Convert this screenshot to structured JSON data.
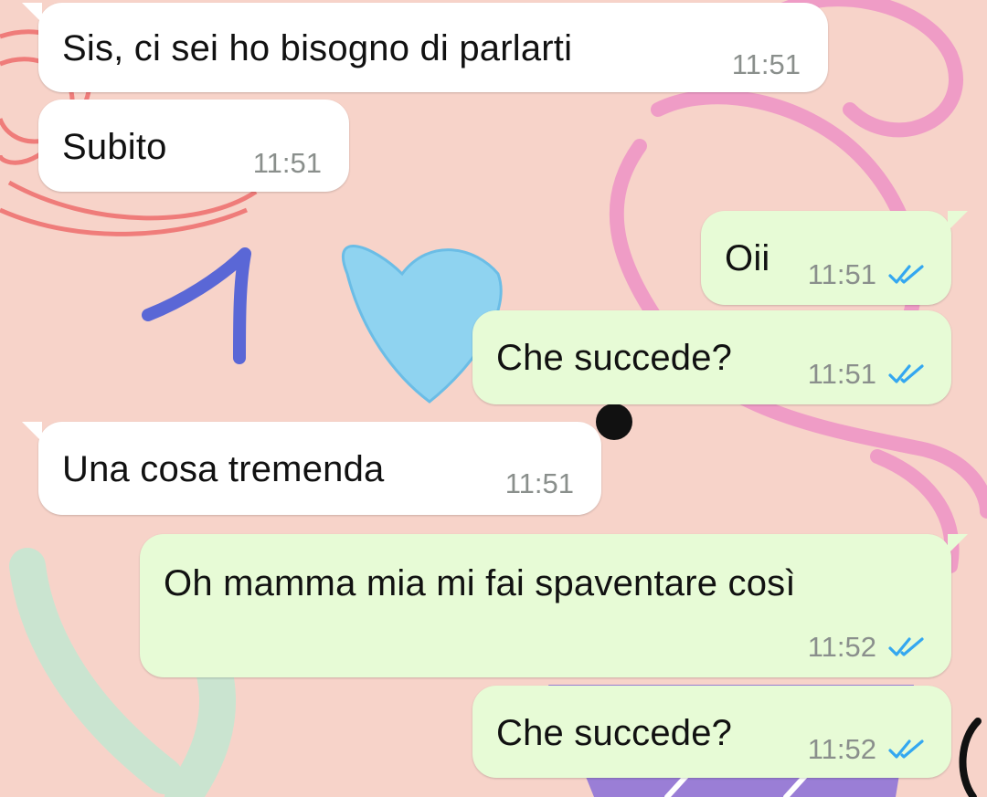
{
  "chat": {
    "messages": [
      {
        "direction": "in",
        "text": "Sis, ci sei ho bisogno di parlarti",
        "time": "11:51"
      },
      {
        "direction": "in",
        "text": "Subito",
        "time": "11:51"
      },
      {
        "direction": "out",
        "text": "Oii",
        "time": "11:51",
        "status": "read"
      },
      {
        "direction": "out",
        "text": "Che succede?",
        "time": "11:51",
        "status": "read"
      },
      {
        "direction": "in",
        "text": "Una cosa tremenda",
        "time": "11:51"
      },
      {
        "direction": "out",
        "text": "Oh mamma mia mi fai spaventare così",
        "time": "11:52",
        "status": "read"
      },
      {
        "direction": "out",
        "text": "Che succede?",
        "time": "11:52",
        "status": "read"
      }
    ]
  },
  "colors": {
    "incoming_bubble": "#ffffff",
    "outgoing_bubble": "#e7fbd6",
    "read_ticks": "#34a7f0",
    "wallpaper": "#f7d3c9",
    "annotation_stroke": "#5a67d6"
  },
  "icons": {
    "read_receipt": "double-check-icon"
  },
  "annotation": {
    "mark": "hand-drawn number one"
  }
}
